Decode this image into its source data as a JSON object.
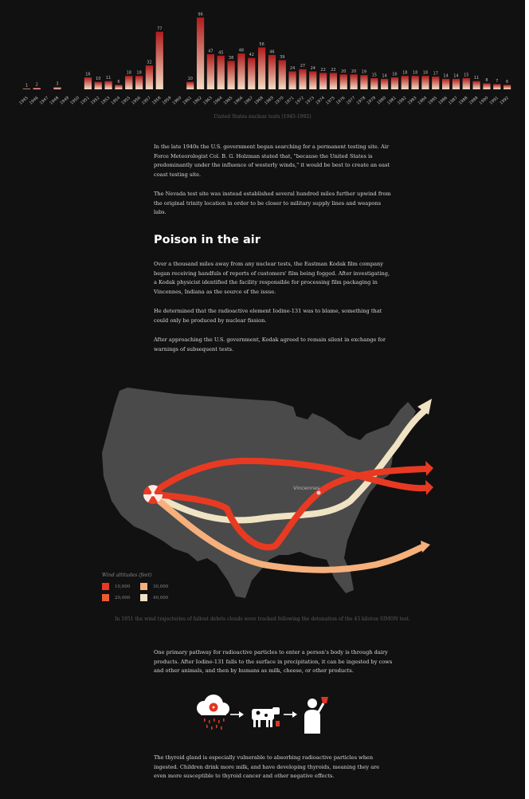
{
  "chart_data": {
    "type": "bar",
    "title": "United States nuclear tests (1945-1992)",
    "categories": [
      "1945",
      "1946",
      "1947",
      "1948",
      "1949",
      "1950",
      "1951",
      "1952",
      "1953",
      "1954",
      "1955",
      "1956",
      "1957",
      "1958",
      "1959",
      "1960",
      "1961",
      "1962",
      "1963",
      "1964",
      "1965",
      "1966",
      "1967",
      "1968",
      "1969",
      "1970",
      "1971",
      "1972",
      "1973",
      "1974",
      "1975",
      "1976",
      "1977",
      "1978",
      "1979",
      "1980",
      "1981",
      "1982",
      "1983",
      "1984",
      "1985",
      "1986",
      "1987",
      "1988",
      "1989",
      "1990",
      "1991",
      "1992"
    ],
    "values": [
      1,
      2,
      0,
      3,
      0,
      0,
      16,
      10,
      11,
      6,
      18,
      18,
      32,
      77,
      0,
      0,
      10,
      96,
      47,
      45,
      38,
      48,
      42,
      56,
      46,
      39,
      24,
      27,
      24,
      22,
      22,
      20,
      20,
      19,
      15,
      14,
      16,
      18,
      18,
      18,
      17,
      14,
      14,
      15,
      11,
      8,
      7,
      6
    ],
    "gradient": {
      "bottom": "#f4dcc4",
      "top": "#b01c1c"
    },
    "label_color": "#bfbfbf"
  },
  "text": {
    "p1": "In the late 1940s the U.S. government began searching for a permanent testing site. Air Force Meteorologist Col. B. G. Holzman stated that, \"because the United States is predominantly under the influence of westerly winds,\" it would be best to create an east coast testing site.",
    "p2": "The Nevada test site was instead established several hundred miles further upwind from the original trinity location in order to be closer to military supply lines and weapons labs.",
    "heading": "Poison in the air",
    "p3": "Over a thousand miles away from any nuclear tests, the Eastman Kodak film company began receiving handfuls of reports of customers' film being fogged. After investigating, a Kodak physicist identified the facility responsible for processing film packaging in Vincennes, Indiana as the source of the issue.",
    "p4": "He determined that the radioactive element Iodine-131 was to blame, something that could only be produced by nuclear fission.",
    "p5": "After approaching the U.S. government, Kodak agreed to remain silent in exchange for warnings of subsequent tests.",
    "map_caption": "In 1951 the wind trajectories of fallout debris clouds were tracked following the detonation of the 43 kiloton SIMON test.",
    "p6": "One primary pathway for radioactive particles to enter a person's body is through dairy products. After Iodine-131 falls to the surface in precipitation, it can be ingested by cows and other animals, and then by humans as milk, cheese, or other products.",
    "p7": "The thyroid gland is especially vulnerable to absorbing radioactive particles when ingested. Children drink more milk, and have developing thyroids, meaning they are even more susceptible to thyroid cancer and other negative effects."
  },
  "map": {
    "city_label": "Vincennes",
    "land_color": "#4a4a4a",
    "legend_title": "Wind altitudes (feet)",
    "legend": [
      {
        "label": "10,000",
        "color": "#e83a22"
      },
      {
        "label": "20,000",
        "color": "#ee5a36"
      },
      {
        "label": "30,000",
        "color": "#f6b07c"
      },
      {
        "label": "40,000",
        "color": "#efe3c4"
      }
    ]
  },
  "icons": [
    "radiation-cloud-icon",
    "arrow-right-icon",
    "cow-icon",
    "arrow-right-icon",
    "person-drinking-icon"
  ]
}
